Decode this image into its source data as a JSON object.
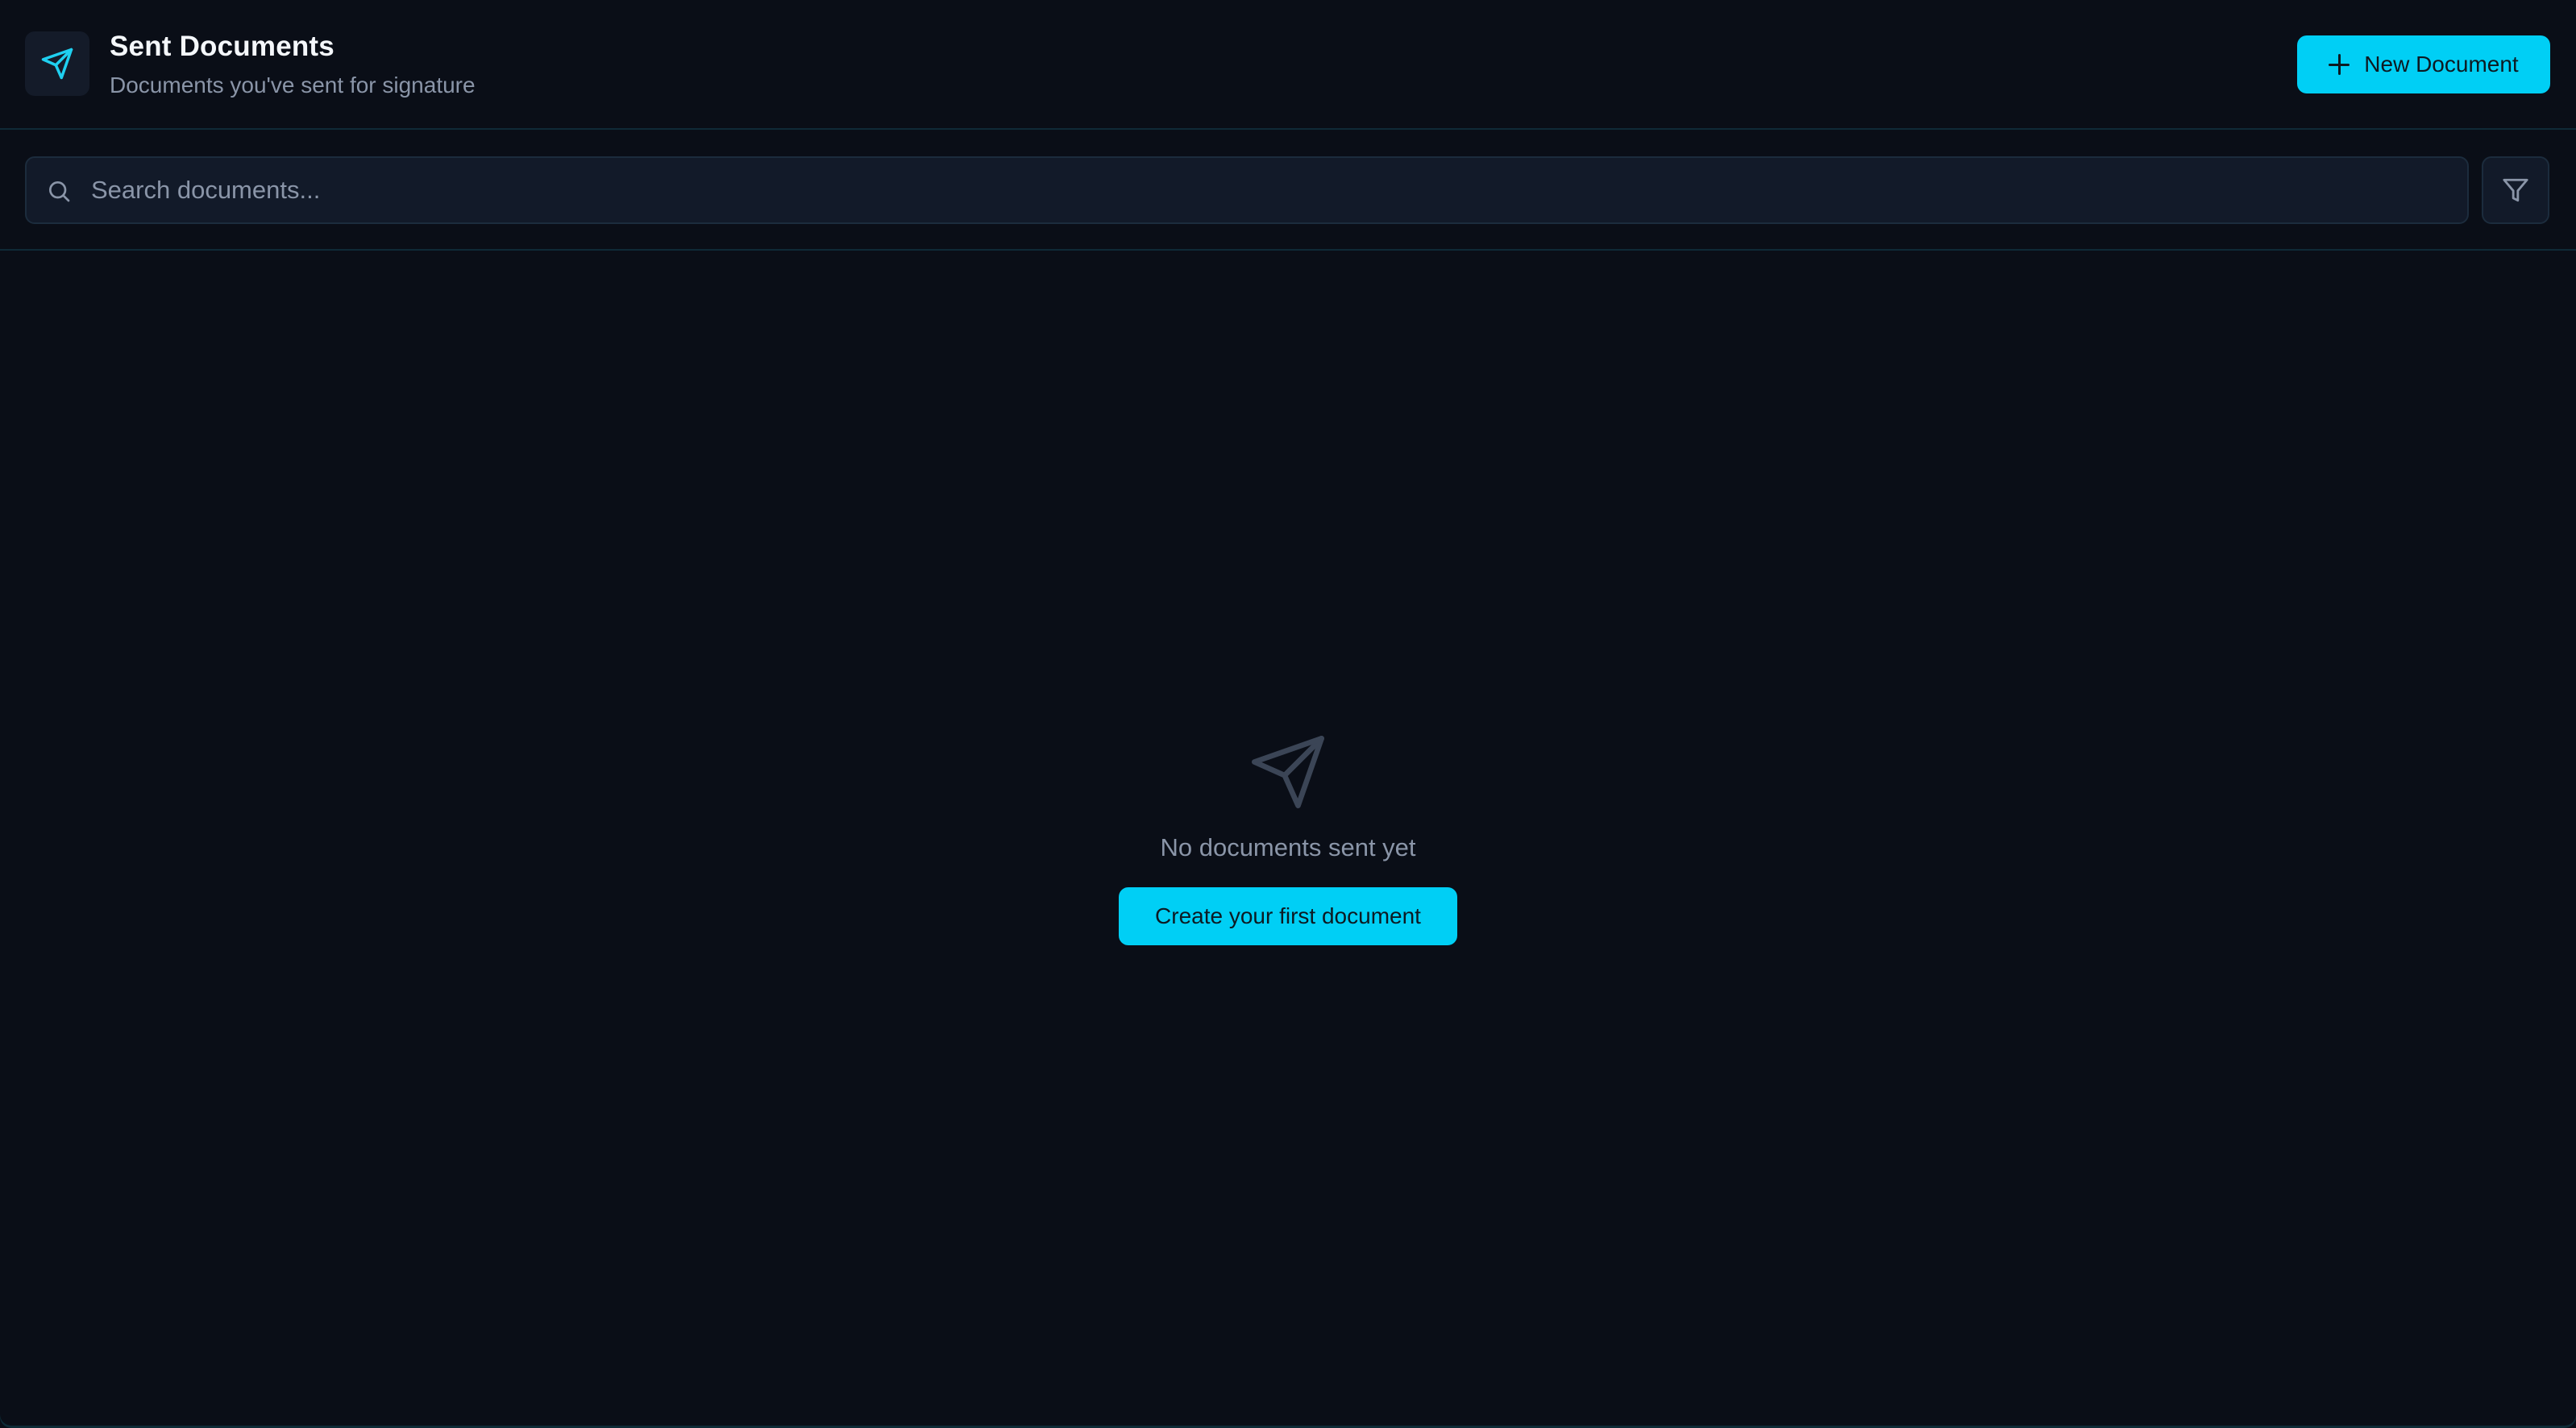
{
  "header": {
    "icon": "send-icon",
    "title": "Sent Documents",
    "subtitle": "Documents you've sent for signature",
    "new_button_label": "New Document"
  },
  "search": {
    "placeholder": "Search documents...",
    "value": "",
    "filter_icon": "filter-icon"
  },
  "empty_state": {
    "icon": "send-icon",
    "message": "No documents sent yet",
    "cta_label": "Create your first document"
  },
  "colors": {
    "background": "#0a0e17",
    "accent": "#00cff5",
    "muted_text": "#8a95a8",
    "border": "#0f2a37"
  }
}
